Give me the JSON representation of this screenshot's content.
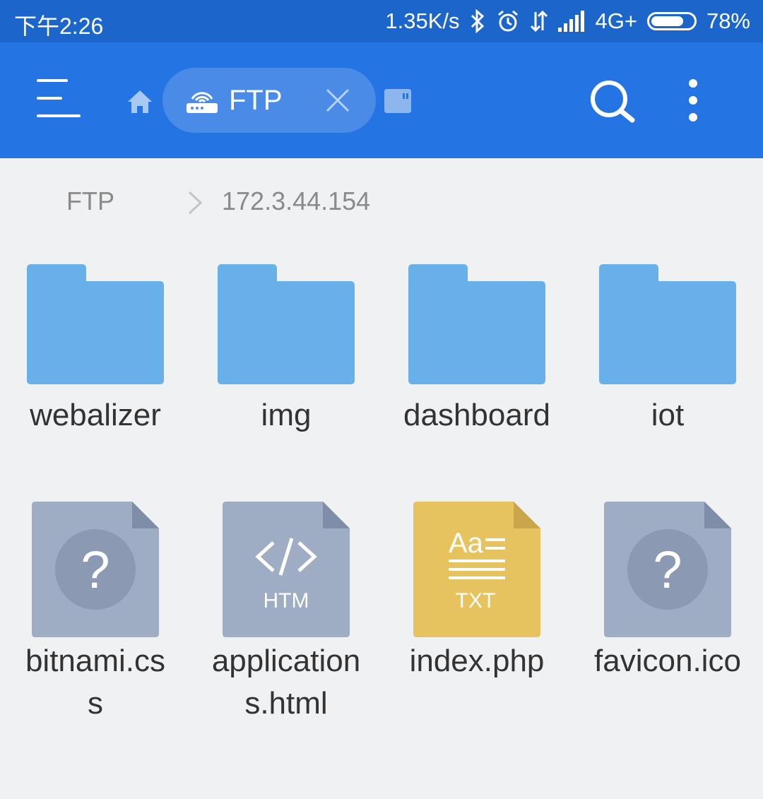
{
  "status_bar": {
    "time": "下午2:26",
    "network_speed": "1.35K/s",
    "network_type": "4G+",
    "battery_percent": "78%",
    "battery_level": 0.78,
    "icons": [
      "bluetooth-icon",
      "alarm-icon",
      "data-arrows-icon",
      "signal-icon"
    ]
  },
  "toolbar": {
    "menu_icon": "hamburger-menu-icon",
    "home_icon": "home-icon",
    "active_tab": {
      "label": "FTP",
      "icon": "ftp-router-icon",
      "close_icon": "close-icon"
    },
    "storage_icon": "sd-card-icon",
    "search_icon": "search-icon",
    "more_icon": "more-vertical-icon"
  },
  "breadcrumb": {
    "root": "FTP",
    "current": "172.3.44.154"
  },
  "colors": {
    "status_bar": "#1c66cb",
    "toolbar": "#2474e3",
    "folder": "#67b0e8",
    "unknown_file": "#9eacc4",
    "text_file": "#e6c35f"
  },
  "files": [
    {
      "name": "webalizer",
      "type": "folder",
      "icon": "folder-icon"
    },
    {
      "name": "img",
      "type": "folder",
      "icon": "folder-icon"
    },
    {
      "name": "dashboard",
      "type": "folder",
      "icon": "folder-icon"
    },
    {
      "name": "iot",
      "type": "folder",
      "icon": "folder-icon"
    },
    {
      "name_lines": [
        "bitnami.cs",
        "s"
      ],
      "type": "unknown",
      "icon": "unknown-file-icon"
    },
    {
      "name_lines": [
        "application",
        "s.html"
      ],
      "type": "html",
      "icon": "html-file-icon",
      "badge": "HTM"
    },
    {
      "name": "index.php",
      "type": "text",
      "icon": "text-file-icon",
      "badge": "TXT",
      "glyph": "Aa"
    },
    {
      "name": "favicon.ico",
      "type": "unknown",
      "icon": "unknown-file-icon"
    }
  ]
}
